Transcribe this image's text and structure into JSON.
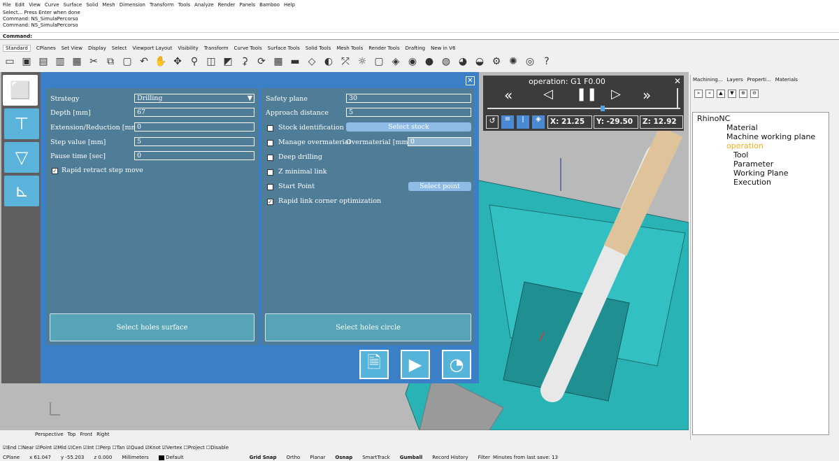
{
  "menu": [
    "File",
    "Edit",
    "View",
    "Curve",
    "Surface",
    "Solid",
    "Mesh",
    "Dimension",
    "Transform",
    "Tools",
    "Analyze",
    "Render",
    "Panels",
    "Bamboo",
    "Help"
  ],
  "command_history": [
    "Select... Press Enter when done",
    "Command: NS_SimulaPercorso",
    "Command: NS_SimulaPercorso"
  ],
  "command_prompt": "Command:",
  "toolbar_tabs": [
    "Standard",
    "CPlanes",
    "Set View",
    "Display",
    "Select",
    "Viewport Layout",
    "Visibility",
    "Transform",
    "Curve Tools",
    "Surface Tools",
    "Solid Tools",
    "Mesh Tools",
    "Render Tools",
    "Drafting",
    "New in V6"
  ],
  "toolbar_icons": [
    "new-icon",
    "open-icon",
    "save-icon",
    "print-icon",
    "import-icon",
    "cut-icon",
    "copy-icon",
    "paste-icon",
    "undo-icon",
    "pan-icon",
    "rotate-icon",
    "zoom-icon",
    "zoom-window-icon",
    "zoom-extents-icon",
    "zoom-selected-icon",
    "rotate-view-icon",
    "viewport-icon",
    "car-icon",
    "layer-icon",
    "object-props-icon",
    "select-icon",
    "light-icon",
    "lock-icon",
    "material-icon",
    "color-wheel-icon",
    "render-icon",
    "rendered-sphere-icon",
    "environment-icon",
    "ghosted-icon",
    "options-icon",
    "gear-icon",
    "world-icon",
    "help-icon"
  ],
  "form": {
    "strategy_label": "Strategy",
    "strategy_value": "Drilling",
    "depth_label": "Depth [mm]",
    "depth_value": "67",
    "ext_label": "Extension/Reduction [mm]",
    "ext_value": "0",
    "step_label": "Step value [mm]",
    "step_value": "5",
    "pause_label": "Pause time [sec]",
    "pause_value": "0",
    "rapid_retract_label": "Rapid retract step move",
    "safety_label": "Safety plane",
    "safety_value": "30",
    "approach_label": "Approach distance",
    "approach_value": "5",
    "stock_label": "Stock identification",
    "select_stock": "Select stock",
    "overmat_label": "Manage overmaterial",
    "overmat_mm_label": "Overmaterial [mm]",
    "overmat_value": "0",
    "deep_label": "Deep drilling",
    "zlink_label": "Z minimal link",
    "start_label": "Start Point",
    "select_point": "Select point",
    "rapid_link_label": "Rapid link corner optimization",
    "select_holes_surface": "Select holes surface",
    "select_holes_circle": "Select holes circle"
  },
  "sim": {
    "title": "operation: G1 F0.00",
    "x": "X: 21.25",
    "y": "Y: -29.50",
    "z": "Z: 12.92",
    "progress": 0.6
  },
  "right_tabs": [
    "Machining...",
    "Layers",
    "Properti...",
    "Materials"
  ],
  "tree": {
    "root": "RhinoNC",
    "material": "Material",
    "mwp": "Machine working plane",
    "operation": "operation",
    "tool": "Tool",
    "parameter": "Parameter",
    "working_plane": "Working Plane",
    "execution": "Execution"
  },
  "viewport_tabs": [
    "Perspective",
    "Top",
    "Front",
    "Right"
  ],
  "osnaps": [
    [
      "End",
      true
    ],
    [
      "Near",
      false
    ],
    [
      "Point",
      true
    ],
    [
      "Mid",
      true
    ],
    [
      "Cen",
      true
    ],
    [
      "Int",
      true
    ],
    [
      "Perp",
      false
    ],
    [
      "Tan",
      false
    ],
    [
      "Quad",
      true
    ],
    [
      "Knot",
      true
    ],
    [
      "Vertex",
      true
    ],
    [
      "Project",
      false
    ],
    [
      "Disable",
      false
    ]
  ],
  "status": {
    "cplane": "CPlane",
    "x": "x 61.047",
    "y": "y -55.203",
    "z": "z 0.000",
    "units": "Millimeters",
    "layer": "Default",
    "grid": "Grid Snap",
    "ortho": "Ortho",
    "planar": "Planar",
    "osnap": "Osnap",
    "smarttrack": "SmartTrack",
    "gumball": "Gumball",
    "history": "Record History",
    "filter": "Filter",
    "save": "Minutes from last save: 13"
  },
  "colors": {
    "panel": "#3b7fc7",
    "column": "#4f7c97",
    "model": "#2ab3b5"
  }
}
